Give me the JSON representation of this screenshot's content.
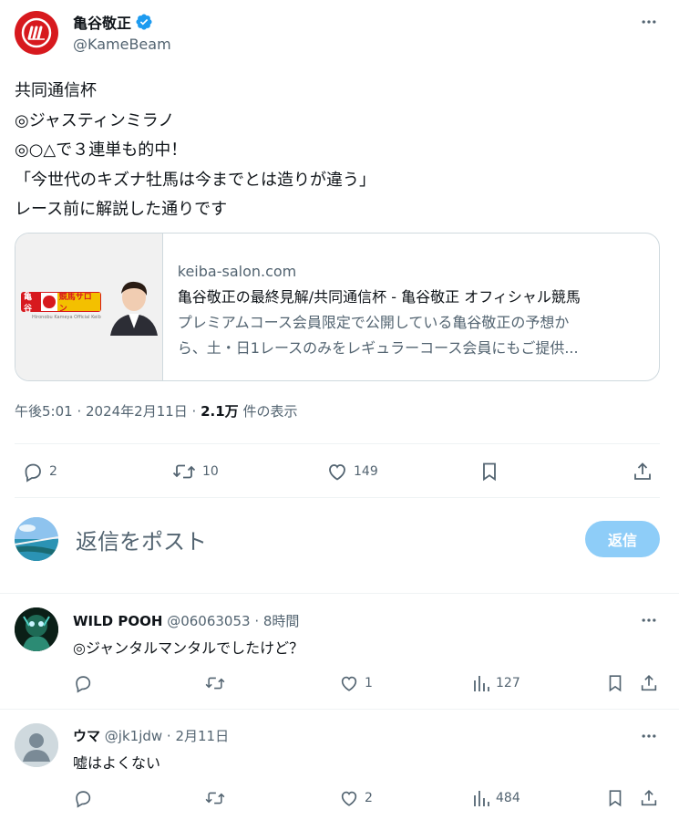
{
  "tweet": {
    "author_name": "亀谷敬正",
    "author_handle": "@KameBeam",
    "text_lines": [
      "共同通信杯",
      "◎ジャスティンミラノ",
      "◎○△で３連単も的中！",
      "「今世代のキズナ牡馬は今までとは造りが違う」",
      "レース前に解説した通りです"
    ],
    "card": {
      "domain": "keiba-salon.com",
      "title": "亀谷敬正の最終見解/共同通信杯 - 亀谷敬正 オフィシャル競馬",
      "description_line1": "プレミアムコース会員限定で公開している亀谷敬正の予想か",
      "description_line2": "ら、土・日1レースのみをレギュラーコース会員にもご提供...",
      "thumb_logo_left": "亀谷",
      "thumb_logo_right": "競馬サロン",
      "thumb_caption": "Hironobu Kameya Official Keiba Salon"
    },
    "timestamp": "午後5:01 · 2024年2月11日 · ",
    "views_count": "2.1万",
    "views_label": " 件の表示",
    "actions": {
      "replies": "2",
      "reposts": "10",
      "likes": "149"
    }
  },
  "composer": {
    "placeholder": "返信をポスト",
    "button_label": "返信"
  },
  "replies": [
    {
      "name": "WILD POOH",
      "handle": "@06063053 · 8時間",
      "text": "◎ジャンタルマンタルでしたけど？",
      "likes": "1",
      "views": "127"
    },
    {
      "name": "ウマ",
      "handle": "@jk1jdw · 2月11日",
      "text": "嘘はよくない",
      "likes": "2",
      "views": "484"
    }
  ],
  "colors": {
    "brand_red": "#d7191e",
    "verified_blue": "#1d9bf0",
    "reply_button": "#8ecdf8",
    "secondary_text": "#536471"
  }
}
